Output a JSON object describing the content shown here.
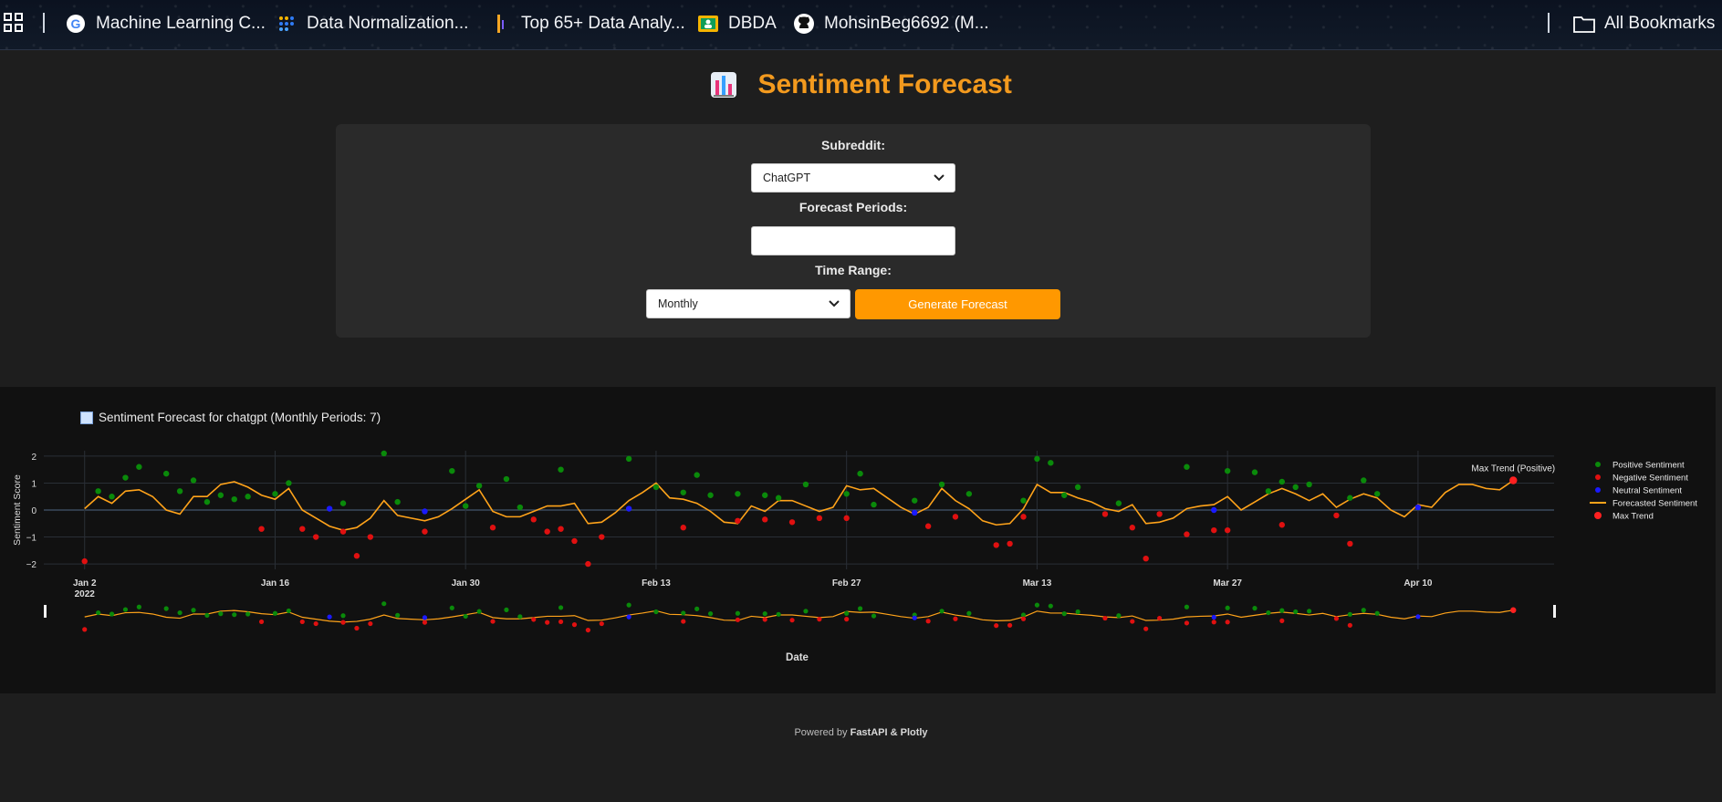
{
  "bookmarks": {
    "items": [
      {
        "label": "Machine Learning C...",
        "icon": "google-icon"
      },
      {
        "label": "Data Normalization...",
        "icon": "dots-icon"
      },
      {
        "label": "Top 65+ Data Analy...",
        "icon": "bars-icon"
      },
      {
        "label": "DBDA",
        "icon": "classroom-icon"
      },
      {
        "label": "MohsinBeg6692 (M...",
        "icon": "github-icon"
      }
    ],
    "all_label": "All Bookmarks"
  },
  "header": {
    "title": "Sentiment Forecast"
  },
  "form": {
    "subreddit_label": "Subreddit:",
    "subreddit_value": "ChatGPT",
    "periods_label": "Forecast Periods:",
    "periods_value": "",
    "timerange_label": "Time Range:",
    "timerange_value": "Monthly",
    "generate_label": "Generate Forecast"
  },
  "chart_data": {
    "type": "scatter",
    "title": "Sentiment Forecast for chatgpt (Monthly Periods: 7)",
    "xlabel": "Date",
    "ylabel": "Sentiment Score",
    "x_ticks": [
      "Jan 2\n2022",
      "Jan 16",
      "Jan 30",
      "Feb 13",
      "Feb 27",
      "Mar 13",
      "Mar 27",
      "Apr 10"
    ],
    "y_ticks": [
      "2",
      "1",
      "0",
      "−1",
      "−2"
    ],
    "ylim": [
      -2.2,
      2.2
    ],
    "xlim_days": [
      -3,
      108
    ],
    "grid": true,
    "legend_position": "right",
    "legend": [
      {
        "name": "Positive Sentiment",
        "color": "#0a8a0a"
      },
      {
        "name": "Negative Sentiment",
        "color": "#e01010"
      },
      {
        "name": "Neutral Sentiment",
        "color": "#1a1aff"
      },
      {
        "name": "Forecasted Sentiment",
        "color": "#ffa31a"
      },
      {
        "name": "Max Trend",
        "color": "#ff2020"
      }
    ],
    "annotation": {
      "text": "Max Trend (Positive)",
      "x": 105,
      "y": 1.1
    },
    "series": [
      {
        "name": "Positive Sentiment",
        "points": [
          [
            1,
            0.7
          ],
          [
            2,
            0.5
          ],
          [
            3,
            1.2
          ],
          [
            4,
            1.6
          ],
          [
            6,
            1.35
          ],
          [
            7,
            0.7
          ],
          [
            8,
            1.1
          ],
          [
            9,
            0.3
          ],
          [
            10,
            0.55
          ],
          [
            11,
            0.4
          ],
          [
            12,
            0.5
          ],
          [
            14,
            0.6
          ],
          [
            15,
            1.0
          ],
          [
            19,
            0.25
          ],
          [
            22,
            2.1
          ],
          [
            23,
            0.3
          ],
          [
            27,
            1.45
          ],
          [
            28,
            0.15
          ],
          [
            29,
            0.9
          ],
          [
            31,
            1.15
          ],
          [
            32,
            0.1
          ],
          [
            35,
            1.5
          ],
          [
            40,
            1.9
          ],
          [
            42,
            0.85
          ],
          [
            44,
            0.65
          ],
          [
            45,
            1.3
          ],
          [
            46,
            0.55
          ],
          [
            48,
            0.6
          ],
          [
            50,
            0.55
          ],
          [
            51,
            0.45
          ],
          [
            53,
            0.95
          ],
          [
            56,
            0.6
          ],
          [
            57,
            1.35
          ],
          [
            58,
            0.2
          ],
          [
            61,
            0.35
          ],
          [
            63,
            0.95
          ],
          [
            65,
            0.6
          ],
          [
            69,
            0.35
          ],
          [
            70,
            1.9
          ],
          [
            71,
            1.75
          ],
          [
            72,
            0.55
          ],
          [
            73,
            0.85
          ],
          [
            76,
            0.25
          ],
          [
            81,
            1.6
          ],
          [
            84,
            1.45
          ],
          [
            86,
            1.4
          ],
          [
            87,
            0.7
          ],
          [
            88,
            1.05
          ],
          [
            89,
            0.85
          ],
          [
            90,
            0.95
          ],
          [
            93,
            0.45
          ],
          [
            94,
            1.1
          ],
          [
            95,
            0.6
          ]
        ]
      },
      {
        "name": "Negative Sentiment",
        "points": [
          [
            0,
            -1.9
          ],
          [
            13,
            -0.7
          ],
          [
            16,
            -0.7
          ],
          [
            17,
            -1.0
          ],
          [
            19,
            -0.8
          ],
          [
            20,
            -1.7
          ],
          [
            21,
            -1.0
          ],
          [
            25,
            -0.8
          ],
          [
            30,
            -0.65
          ],
          [
            33,
            -0.35
          ],
          [
            34,
            -0.8
          ],
          [
            35,
            -0.7
          ],
          [
            36,
            -1.15
          ],
          [
            37,
            -2.0
          ],
          [
            38,
            -1.0
          ],
          [
            44,
            -0.65
          ],
          [
            48,
            -0.4
          ],
          [
            50,
            -0.35
          ],
          [
            52,
            -0.45
          ],
          [
            54,
            -0.3
          ],
          [
            56,
            -0.3
          ],
          [
            62,
            -0.6
          ],
          [
            64,
            -0.25
          ],
          [
            67,
            -1.3
          ],
          [
            68,
            -1.25
          ],
          [
            69,
            -0.25
          ],
          [
            75,
            -0.15
          ],
          [
            77,
            -0.65
          ],
          [
            78,
            -1.8
          ],
          [
            79,
            -0.15
          ],
          [
            81,
            -0.9
          ],
          [
            83,
            -0.75
          ],
          [
            84,
            -0.75
          ],
          [
            88,
            -0.55
          ],
          [
            92,
            -0.2
          ],
          [
            93,
            -1.25
          ],
          [
            105,
            1.1
          ]
        ]
      },
      {
        "name": "Neutral Sentiment",
        "points": [
          [
            18,
            0.05
          ],
          [
            25,
            -0.05
          ],
          [
            40,
            0.05
          ],
          [
            61,
            -0.1
          ],
          [
            83,
            0.0
          ],
          [
            98,
            0.1
          ]
        ]
      },
      {
        "name": "Forecasted Sentiment",
        "points": [
          [
            0,
            0.05
          ],
          [
            1,
            0.5
          ],
          [
            2,
            0.25
          ],
          [
            3,
            0.7
          ],
          [
            4,
            0.75
          ],
          [
            5,
            0.5
          ],
          [
            6,
            0.0
          ],
          [
            7,
            -0.15
          ],
          [
            8,
            0.5
          ],
          [
            9,
            0.5
          ],
          [
            10,
            0.95
          ],
          [
            11,
            1.05
          ],
          [
            12,
            0.85
          ],
          [
            13,
            0.55
          ],
          [
            14,
            0.4
          ],
          [
            15,
            0.8
          ],
          [
            16,
            0.0
          ],
          [
            17,
            -0.3
          ],
          [
            18,
            -0.6
          ],
          [
            19,
            -0.75
          ],
          [
            20,
            -0.65
          ],
          [
            21,
            -0.3
          ],
          [
            22,
            0.35
          ],
          [
            23,
            -0.2
          ],
          [
            24,
            -0.3
          ],
          [
            25,
            -0.4
          ],
          [
            26,
            -0.25
          ],
          [
            27,
            0.05
          ],
          [
            28,
            0.4
          ],
          [
            29,
            0.75
          ],
          [
            30,
            -0.05
          ],
          [
            31,
            -0.25
          ],
          [
            32,
            -0.25
          ],
          [
            33,
            -0.05
          ],
          [
            34,
            0.15
          ],
          [
            35,
            0.15
          ],
          [
            36,
            0.25
          ],
          [
            37,
            -0.5
          ],
          [
            38,
            -0.45
          ],
          [
            39,
            -0.1
          ],
          [
            40,
            0.35
          ],
          [
            41,
            0.65
          ],
          [
            42,
            1.0
          ],
          [
            43,
            0.45
          ],
          [
            44,
            0.4
          ],
          [
            45,
            0.25
          ],
          [
            46,
            -0.05
          ],
          [
            47,
            -0.45
          ],
          [
            48,
            -0.5
          ],
          [
            49,
            0.15
          ],
          [
            50,
            -0.05
          ],
          [
            51,
            0.35
          ],
          [
            52,
            0.35
          ],
          [
            53,
            0.15
          ],
          [
            54,
            -0.05
          ],
          [
            55,
            0.1
          ],
          [
            56,
            0.9
          ],
          [
            57,
            0.75
          ],
          [
            58,
            0.8
          ],
          [
            59,
            0.45
          ],
          [
            60,
            0.1
          ],
          [
            61,
            -0.15
          ],
          [
            62,
            0.1
          ],
          [
            63,
            0.8
          ],
          [
            64,
            0.35
          ],
          [
            65,
            0.05
          ],
          [
            66,
            -0.4
          ],
          [
            67,
            -0.55
          ],
          [
            68,
            -0.5
          ],
          [
            69,
            0.05
          ],
          [
            70,
            0.95
          ],
          [
            71,
            0.65
          ],
          [
            72,
            0.65
          ],
          [
            73,
            0.45
          ],
          [
            74,
            0.3
          ],
          [
            75,
            0.05
          ],
          [
            76,
            -0.05
          ],
          [
            77,
            0.2
          ],
          [
            78,
            -0.5
          ],
          [
            79,
            -0.45
          ],
          [
            80,
            -0.3
          ],
          [
            81,
            0.05
          ],
          [
            82,
            0.15
          ],
          [
            83,
            0.2
          ],
          [
            84,
            0.5
          ],
          [
            85,
            0.0
          ],
          [
            86,
            0.3
          ],
          [
            87,
            0.6
          ],
          [
            88,
            0.8
          ],
          [
            89,
            0.6
          ],
          [
            90,
            0.35
          ],
          [
            91,
            0.6
          ],
          [
            92,
            0.1
          ],
          [
            93,
            0.4
          ],
          [
            94,
            0.6
          ],
          [
            95,
            0.45
          ],
          [
            96,
            0.0
          ],
          [
            97,
            -0.25
          ],
          [
            98,
            0.2
          ],
          [
            99,
            0.1
          ],
          [
            100,
            0.65
          ],
          [
            101,
            0.95
          ],
          [
            102,
            0.95
          ],
          [
            103,
            0.8
          ],
          [
            104,
            0.75
          ],
          [
            105,
            1.1
          ]
        ]
      }
    ]
  },
  "footer": {
    "prefix": "Powered by ",
    "brand": "FastAPI & Plotly"
  }
}
